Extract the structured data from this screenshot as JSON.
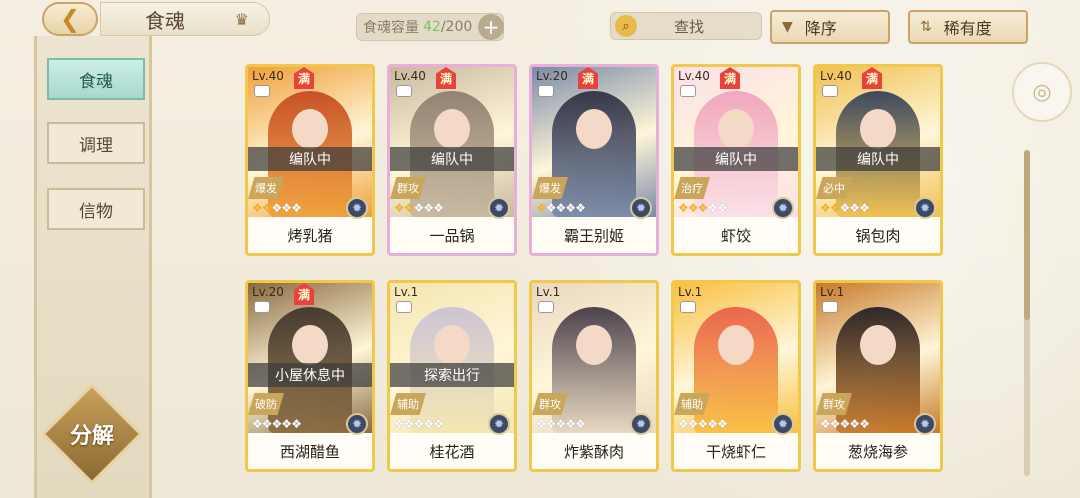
{
  "header": {
    "back_icon": "back-arrow-icon",
    "title": "食魂",
    "capacity_label": "食魂容量",
    "capacity_current": "42",
    "capacity_max": "/200",
    "search_label": "查找",
    "sort_label": "降序",
    "rarity_label": "稀有度"
  },
  "sidebar": {
    "items": [
      {
        "label": "食魂"
      },
      {
        "label": "调理"
      },
      {
        "label": "信物"
      }
    ],
    "decompose_label": "分解"
  },
  "cards": [
    {
      "lv": "Lv.40",
      "full": "满",
      "status": "编队中",
      "role": "爆发",
      "name": "烤乳猪",
      "stars_on": 2,
      "stars_total": 5,
      "colors": [
        "#c2461e",
        "#f0a03a"
      ]
    },
    {
      "lv": "Lv.40",
      "full": "满",
      "status": "编队中",
      "role": "群攻",
      "name": "一品锅",
      "stars_on": 2,
      "stars_total": 5,
      "colors": [
        "#8a7a6a",
        "#c9b8a0"
      ]
    },
    {
      "lv": "Lv.20",
      "full": "满",
      "status": "",
      "role": "爆发",
      "name": "霸王别姬",
      "stars_on": 1,
      "stars_total": 5,
      "colors": [
        "#2a2a3a",
        "#7a8aa8"
      ]
    },
    {
      "lv": "Lv.40",
      "full": "满",
      "status": "编队中",
      "role": "治疗",
      "name": "虾饺",
      "stars_on": 3,
      "stars_total": 5,
      "colors": [
        "#f0a0b8",
        "#fbe0e8"
      ]
    },
    {
      "lv": "Lv.40",
      "full": "满",
      "status": "编队中",
      "role": "必中",
      "name": "锅包肉",
      "stars_on": 2,
      "stars_total": 5,
      "colors": [
        "#2a3a5a",
        "#f0c050"
      ]
    },
    {
      "lv": "Lv.20",
      "full": "满",
      "status": "小屋休息中",
      "role": "破防",
      "name": "西湖醋鱼",
      "stars_on": 0,
      "stars_total": 5,
      "colors": [
        "#3a3028",
        "#8a6a40"
      ]
    },
    {
      "lv": "Lv.1",
      "full": "",
      "status": "探索出行",
      "role": "辅助",
      "name": "桂花酒",
      "stars_on": 0,
      "stars_total": 5,
      "colors": [
        "#c8c0d8",
        "#f4e6b0"
      ]
    },
    {
      "lv": "Lv.1",
      "full": "",
      "status": "",
      "role": "群攻",
      "name": "炸紫酥肉",
      "stars_on": 0,
      "stars_total": 5,
      "colors": [
        "#3a3040",
        "#e8d8c0"
      ]
    },
    {
      "lv": "Lv.1",
      "full": "",
      "status": "",
      "role": "辅助",
      "name": "干烧虾仁",
      "stars_on": 0,
      "stars_total": 5,
      "colors": [
        "#e85a4a",
        "#f8c040"
      ]
    },
    {
      "lv": "Lv.1",
      "full": "",
      "status": "",
      "role": "群攻",
      "name": "葱烧海参",
      "stars_on": 0,
      "stars_total": 5,
      "colors": [
        "#1a1a22",
        "#c87a2a"
      ]
    }
  ],
  "accent_colors": {
    "gold_border": "#f0c84a",
    "active_tab": "#a7d8cc",
    "capacity_current": "#7cc25a"
  }
}
